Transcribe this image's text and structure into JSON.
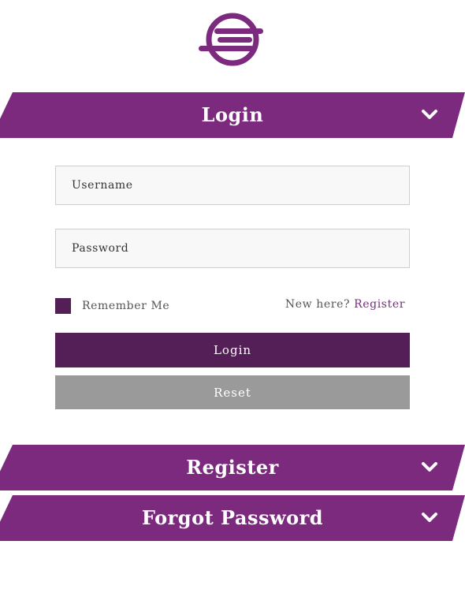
{
  "colors": {
    "brand": "#7b2a7e",
    "brand_dark": "#541e56",
    "grey": "#9a9a9a"
  },
  "logo": {
    "icon": "circle-lines-logo-icon"
  },
  "login_panel": {
    "title": "Login",
    "chevron_icon": "chevron-down-icon",
    "username_placeholder": "Username",
    "password_placeholder": "Password",
    "remember_label": "Remember Me",
    "remember_checked": true,
    "new_here_text": "New here?",
    "register_link": "Register",
    "login_button": "Login",
    "reset_button": "Reset"
  },
  "register_panel": {
    "title": "Register",
    "chevron_icon": "chevron-down-icon"
  },
  "forgot_panel": {
    "title": "Forgot Password",
    "chevron_icon": "chevron-down-icon"
  }
}
